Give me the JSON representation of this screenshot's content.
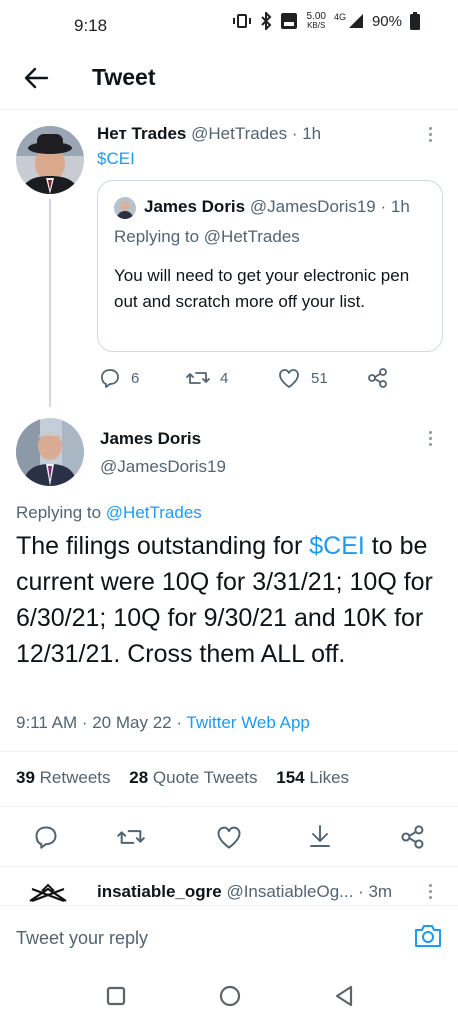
{
  "status_bar": {
    "time": "9:18",
    "speed_value": "5.00",
    "speed_unit": "KB/S",
    "network": "4G",
    "battery": "90%"
  },
  "header": {
    "title": "Tweet"
  },
  "parent_tweet": {
    "display_name": "Нет Trades",
    "handle": "@HetTrades",
    "time": "· 1h",
    "text": "$CEI",
    "quoted": {
      "display_name": "James Doris",
      "handle": "@JamesDoris19",
      "time": "· 1h",
      "replying_prefix": "Replying to ",
      "replying_to": "@HetTrades",
      "text": "You will need to get your electronic pen out and scratch more off your list."
    },
    "replies": "6",
    "retweets": "4",
    "likes": "51"
  },
  "main_tweet": {
    "display_name": "James Doris",
    "handle": "@JamesDoris19",
    "replying_prefix": "Replying to ",
    "replying_to": "@HetTrades",
    "text_before": "The filings outstanding for ",
    "cashtag": "$CEI",
    "text_after": " to be current were 10Q for 3/31/21; 10Q for 6/30/21; 10Q for 9/30/21 and 10K for 12/31/21.  Cross them ALL off.",
    "timestamp": "9:11 AM · 20 May 22 · ",
    "source": "Twitter Web App",
    "retweets_count": "39",
    "retweets_label": "Retweets",
    "quote_count": "28",
    "quote_label": "Quote Tweets",
    "likes_count": "154",
    "likes_label": "Likes"
  },
  "next_reply": {
    "display_name": "insatiable_ogre",
    "handle": "@InsatiableOg...",
    "time": "· 3m"
  },
  "reply_bar": {
    "placeholder": "Tweet your reply"
  },
  "colors": {
    "accent": "#1d9bf0",
    "text": "#0f1419",
    "muted": "#536471"
  }
}
